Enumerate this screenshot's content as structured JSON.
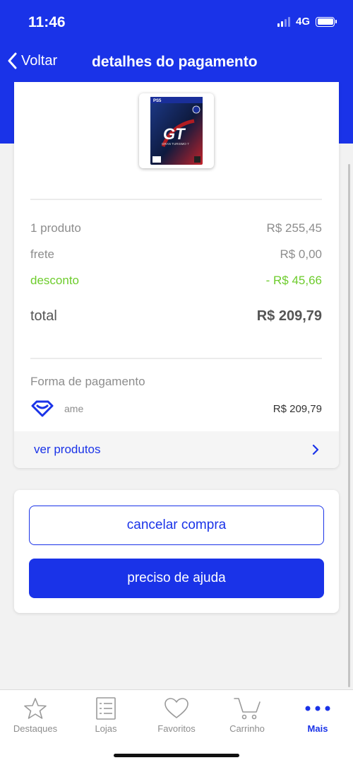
{
  "status_bar": {
    "time": "11:46",
    "network": "4G"
  },
  "nav": {
    "back_label": "Voltar",
    "title": "detalhes do pagamento"
  },
  "product": {
    "platform_badge": "PS5",
    "game_title": "GRAN TURISMO 7"
  },
  "summary": {
    "products_label": "1 produto",
    "products_value": "R$ 255,45",
    "shipping_label": "frete",
    "shipping_value": "R$ 0,00",
    "discount_label": "desconto",
    "discount_value": "- R$ 45,66",
    "total_label": "total",
    "total_value": "R$ 209,79"
  },
  "payment": {
    "label": "Forma de pagamento",
    "method": "ame",
    "amount": "R$ 209,79"
  },
  "see_products": {
    "label": "ver produtos"
  },
  "actions": {
    "cancel_label": "cancelar compra",
    "help_label": "preciso de ajuda"
  },
  "tabs": [
    {
      "label": "Destaques",
      "icon": "star-icon"
    },
    {
      "label": "Lojas",
      "icon": "list-icon"
    },
    {
      "label": "Favoritos",
      "icon": "heart-icon"
    },
    {
      "label": "Carrinho",
      "icon": "cart-icon"
    },
    {
      "label": "Mais",
      "icon": "more-icon",
      "active": true
    }
  ],
  "colors": {
    "brand": "#1a33e8",
    "discount": "#6dcc2c",
    "muted": "#8d8d8d"
  }
}
